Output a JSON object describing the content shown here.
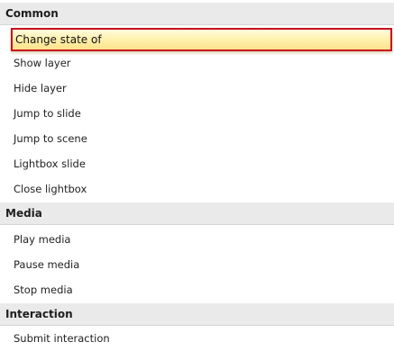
{
  "sections": [
    {
      "title": "Common",
      "items": [
        "Change state of",
        "Show layer",
        "Hide layer",
        "Jump to slide",
        "Jump to scene",
        "Lightbox slide",
        "Close lightbox"
      ]
    },
    {
      "title": "Media",
      "items": [
        "Play media",
        "Pause media",
        "Stop media"
      ]
    },
    {
      "title": "Interaction",
      "items": [
        "Submit interaction"
      ]
    }
  ],
  "selected_item": "Change state of",
  "colors": {
    "header_bg": "#eaeaea",
    "selection_fill": "#fff2b0",
    "selection_border": "#c8121f"
  }
}
